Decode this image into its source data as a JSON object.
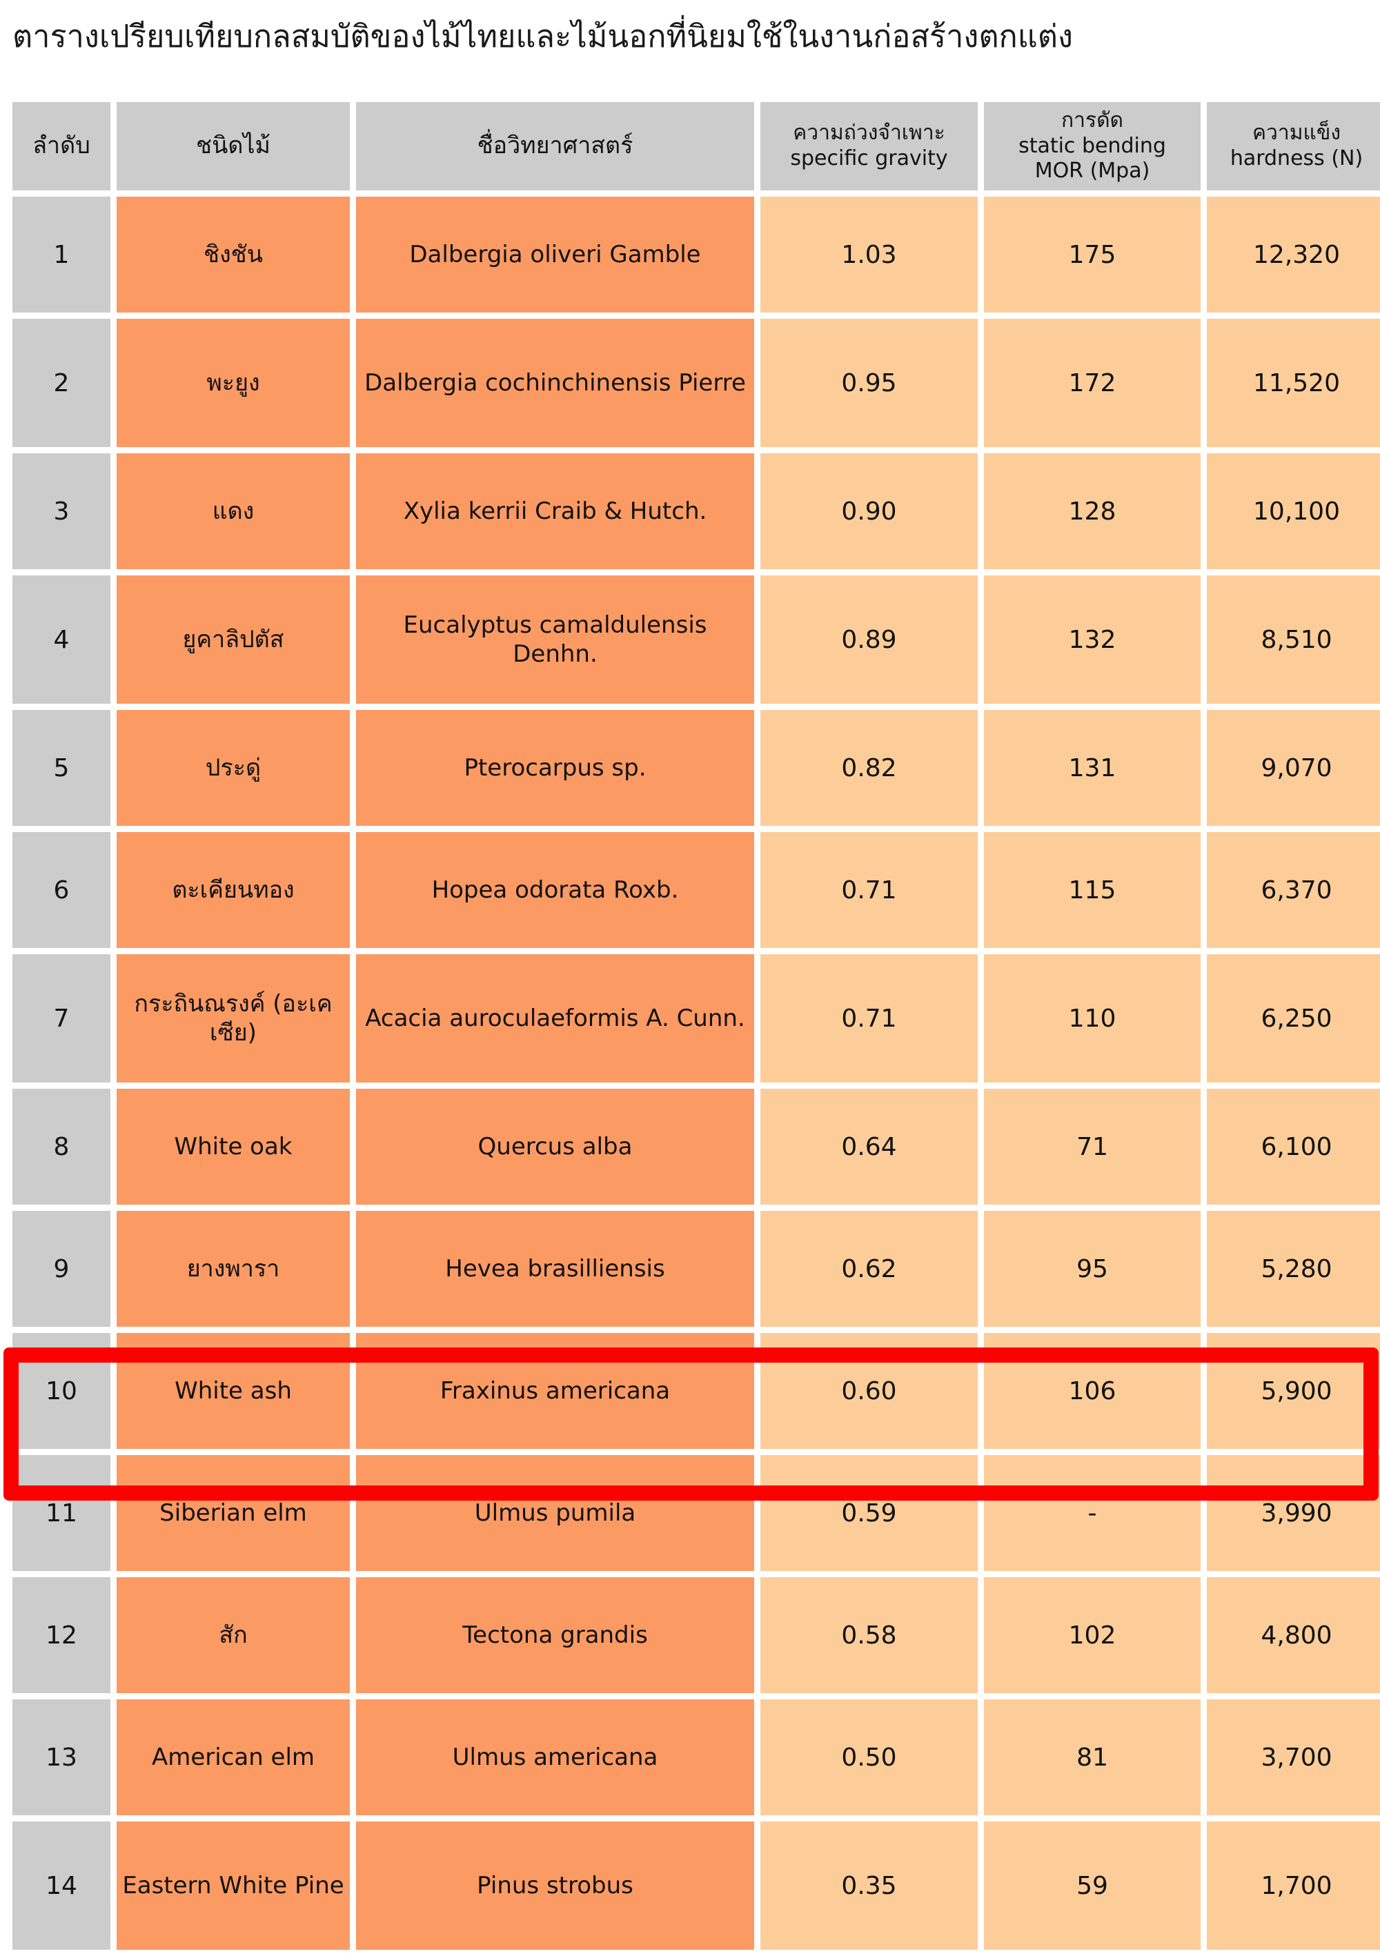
{
  "title": "ตารางเปรียบเทียบกลสมบัติของไม้ไทยและไม้นอกที่นิยมใช้ในงานก่อสร้างตกแต่ง",
  "colors": {
    "header_gray": "#cccccc",
    "dark_orange": "#fc9a64",
    "light_orange": "#fdcd99",
    "highlight_red": "#fb0000",
    "text": "#121212"
  },
  "table": {
    "headers": [
      {
        "line1": "ลำดับ",
        "line2": "",
        "line3": ""
      },
      {
        "line1": "ชนิดไม้",
        "line2": "",
        "line3": ""
      },
      {
        "line1": "ชื่อวิทยาศาสตร์",
        "line2": "",
        "line3": ""
      },
      {
        "line1": "ความถ่วงจำเพาะ",
        "line2": "specific gravity",
        "line3": ""
      },
      {
        "line1": "การดัด",
        "line2": "static bending",
        "line3": "MOR (Mpa)"
      },
      {
        "line1": "ความแข็ง",
        "line2": "hardness (N)",
        "line3": ""
      }
    ],
    "highlighted_row_index": 10,
    "rows": [
      {
        "no": "1",
        "thai": "ชิงชัน",
        "sci": "Dalbergia oliveri Gamble",
        "sg": "1.03",
        "mor": "175",
        "hardness": "12,320"
      },
      {
        "no": "2",
        "thai": "พะยูง",
        "sci": "Dalbergia cochinchinensis Pierre",
        "sg": "0.95",
        "mor": "172",
        "hardness": "11,520"
      },
      {
        "no": "3",
        "thai": "แดง",
        "sci": "Xylia kerrii Craib & Hutch.",
        "sg": "0.90",
        "mor": "128",
        "hardness": "10,100"
      },
      {
        "no": "4",
        "thai": "ยูคาลิปตัส",
        "sci": "Eucalyptus camaldulensis Denhn.",
        "sg": "0.89",
        "mor": "132",
        "hardness": "8,510"
      },
      {
        "no": "5",
        "thai": "ประดู่",
        "sci": "Pterocarpus sp.",
        "sg": "0.82",
        "mor": "131",
        "hardness": "9,070"
      },
      {
        "no": "6",
        "thai": "ตะเคียนทอง",
        "sci": "Hopea odorata Roxb.",
        "sg": "0.71",
        "mor": "115",
        "hardness": "6,370"
      },
      {
        "no": "7",
        "thai": "กระถินณรงค์ (อะเคเซีย)",
        "sci": "Acacia auroculaeformis A. Cunn.",
        "sg": "0.71",
        "mor": "110",
        "hardness": "6,250"
      },
      {
        "no": "8",
        "thai": "White oak",
        "sci": "Quercus alba",
        "sg": "0.64",
        "mor": "71",
        "hardness": "6,100"
      },
      {
        "no": "9",
        "thai": "ยางพารา",
        "sci": "Hevea brasilliensis",
        "sg": "0.62",
        "mor": "95",
        "hardness": "5,280"
      },
      {
        "no": "10",
        "thai": "White ash",
        "sci": "Fraxinus americana",
        "sg": "0.60",
        "mor": "106",
        "hardness": "5,900"
      },
      {
        "no": "11",
        "thai": "Siberian elm",
        "sci": "Ulmus pumila",
        "sg": "0.59",
        "mor": "-",
        "hardness": "3,990"
      },
      {
        "no": "12",
        "thai": "สัก",
        "sci": "Tectona grandis",
        "sg": "0.58",
        "mor": "102",
        "hardness": "4,800"
      },
      {
        "no": "13",
        "thai": "American elm",
        "sci": "Ulmus americana",
        "sg": "0.50",
        "mor": "81",
        "hardness": "3,700"
      },
      {
        "no": "14",
        "thai": "Eastern White Pine",
        "sci": "Pinus strobus",
        "sg": "0.35",
        "mor": "59",
        "hardness": "1,700"
      }
    ]
  }
}
